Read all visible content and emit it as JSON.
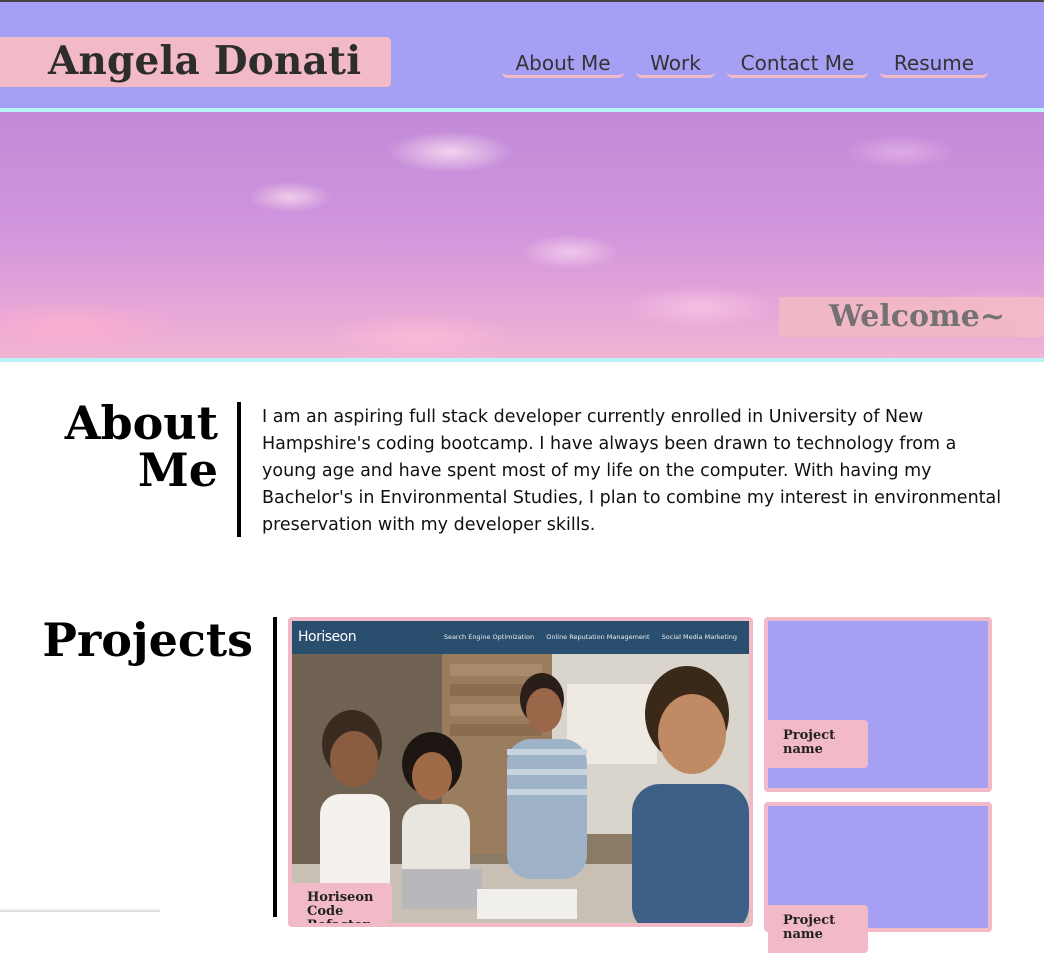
{
  "header": {
    "name": "Angela Donati",
    "nav": [
      {
        "label": "About Me"
      },
      {
        "label": "Work"
      },
      {
        "label": "Contact Me"
      },
      {
        "label": "Resume"
      }
    ]
  },
  "hero": {
    "welcome": "Welcome~"
  },
  "about": {
    "title_line1": "About",
    "title_line2": "Me",
    "text": "I am an aspiring full stack developer currently enrolled in University of New Hampshire's coding bootcamp. I have always been drawn to technology from a young age and have spent most of my life on the computer. With having my Bachelor's in Environmental Studies, I plan to combine my interest in environmental preservation with my developer skills."
  },
  "projects": {
    "title": "Projects",
    "featured": {
      "label": "Horiseon Code Refactor",
      "screenshot": {
        "logo": "Horiseon",
        "menu": [
          "Search Engine Optimization",
          "Online Reputation Management",
          "Social Media Marketing"
        ]
      }
    },
    "cards": [
      {
        "label": "Project name"
      },
      {
        "label": "Project name"
      }
    ]
  },
  "colors": {
    "header_bg": "#a6a0f5",
    "accent_pink": "#f2b9c6",
    "accent_cyan": "#b9f4f8",
    "card_bg": "#a6a0f5"
  }
}
